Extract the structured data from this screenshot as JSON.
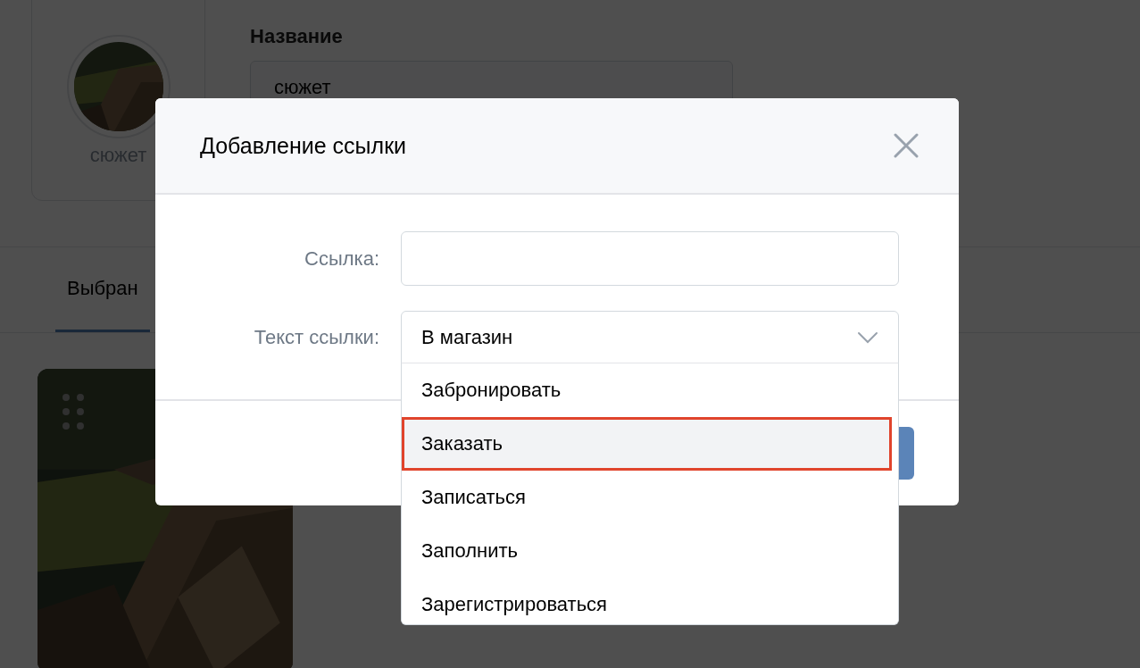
{
  "profile": {
    "name": "сюжет"
  },
  "name_field": {
    "label": "Название",
    "value": "сюжет"
  },
  "tabs": [
    {
      "label": "Выбран",
      "selected": true
    }
  ],
  "dialog": {
    "title": "Добавление ссылки",
    "fields": [
      {
        "kind": "text",
        "label": "Ссылка:"
      },
      {
        "kind": "select",
        "label": "Текст ссылки:",
        "value": "В магазин",
        "expanded": true,
        "options": [
          {
            "label": "Забронировать",
            "selected": false
          },
          {
            "label": "Заказать",
            "selected": true
          },
          {
            "label": "Записаться",
            "selected": false
          },
          {
            "label": "Заполнить",
            "selected": false
          },
          {
            "label": "Зарегистрироваться",
            "selected": false
          }
        ]
      }
    ]
  }
}
